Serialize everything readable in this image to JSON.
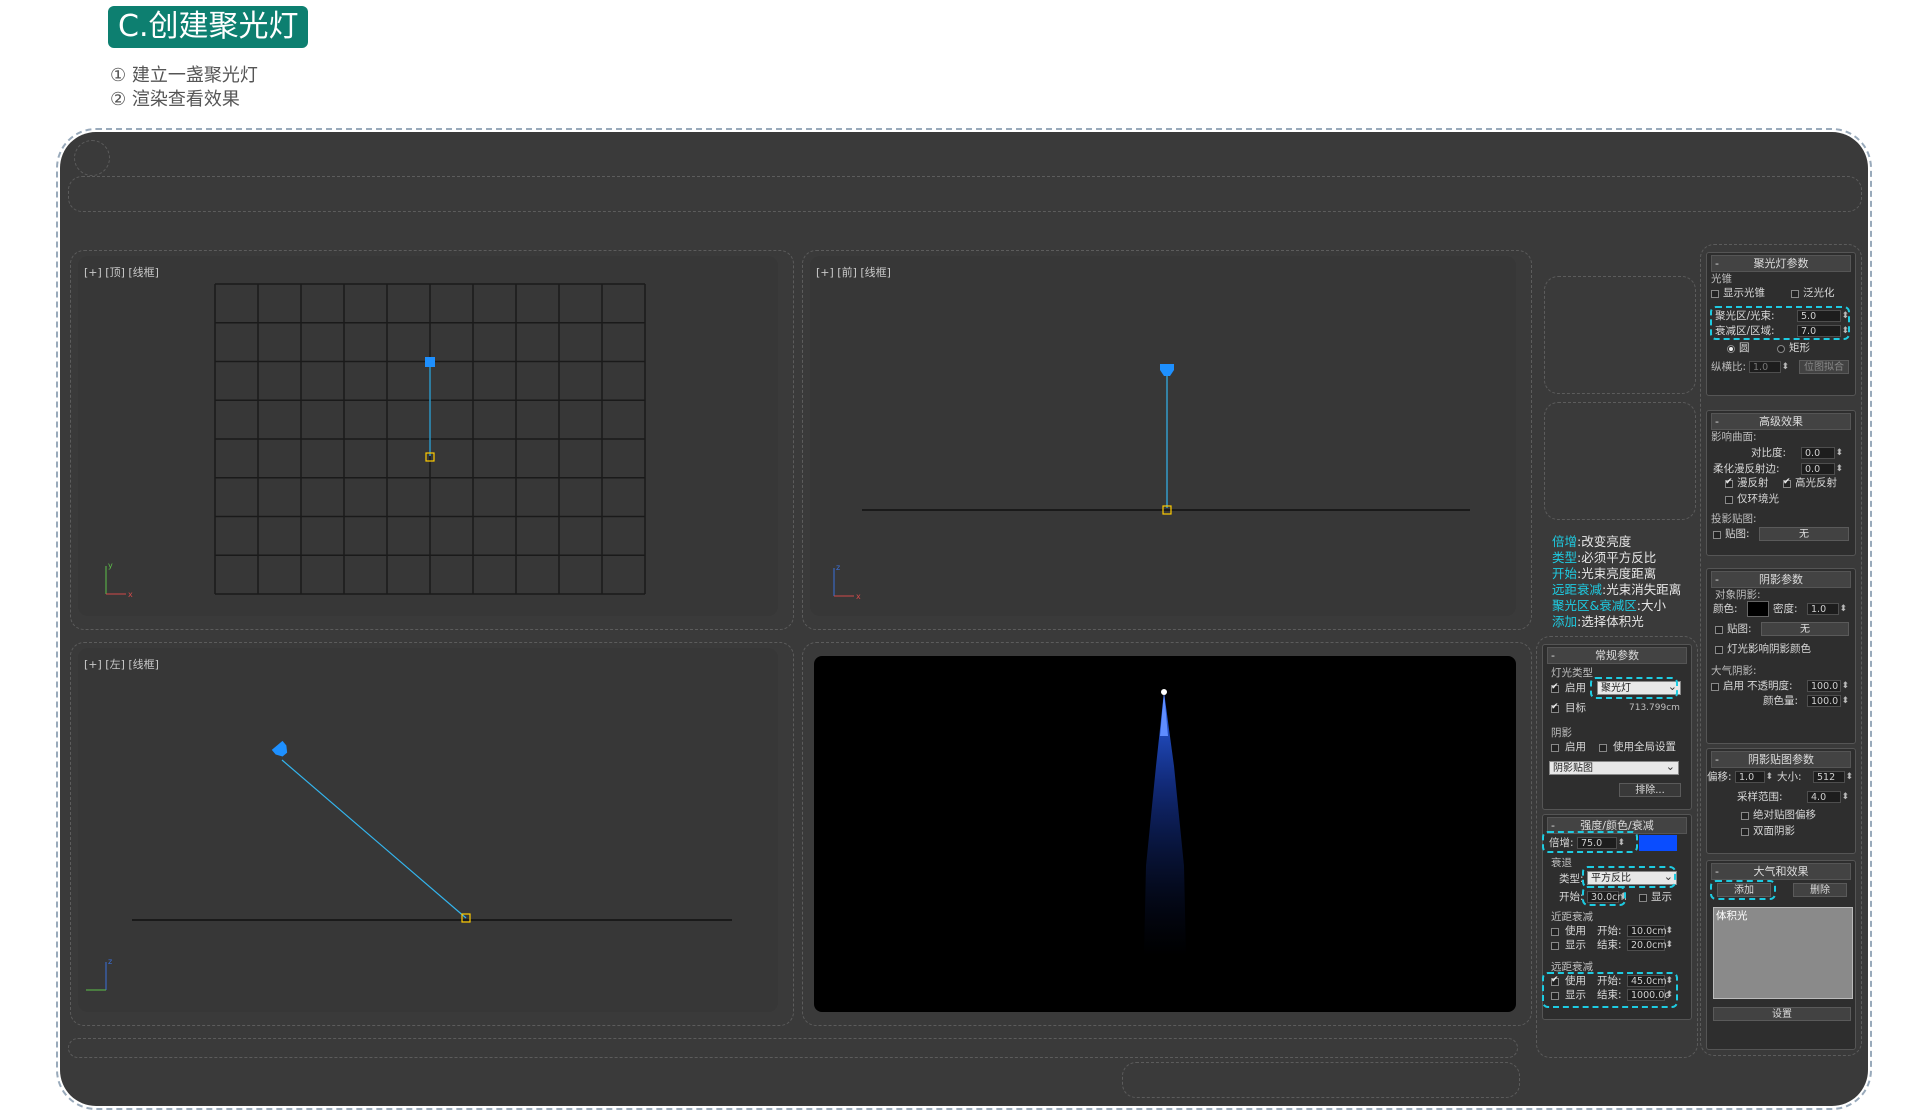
{
  "header": {
    "title": "C.创建聚光灯",
    "step1": "① 建立一盏聚光灯",
    "step2": "② 渲染查看效果"
  },
  "viewports": {
    "top": "[+] [顶] [线框]",
    "front": "[+] [前] [线框]",
    "left": "[+] [左] [线框]"
  },
  "notes": [
    {
      "k": "倍增",
      "v": ":改变亮度"
    },
    {
      "k": "类型",
      "v": ":必须平方反比"
    },
    {
      "k": "开始",
      "v": ":光束亮度距离"
    },
    {
      "k": "远距衰减",
      "v": ":光束消失距离"
    },
    {
      "k": "聚光区&衰减区",
      "v": ":大小"
    },
    {
      "k": "添加",
      "v": ":选择体积光"
    }
  ],
  "general": {
    "title": "常规参数",
    "light_type_group": "灯光类型",
    "enable": "启用",
    "type_value": "聚光灯",
    "target": "目标",
    "target_distance": "713.799cm",
    "shadow_group": "阴影",
    "shadow_enable": "启用",
    "use_global": "使用全局设置",
    "shadow_type": "阴影贴图",
    "exclude": "排除..."
  },
  "intensity": {
    "title": "强度/颜色/衰减",
    "multiplier_label": "倍增:",
    "multiplier_value": "75.0",
    "color": "#0a4dff",
    "decay_group": "衰退",
    "type_label": "类型:",
    "type_value": "平方反比",
    "start_label": "开始:",
    "start_value": "30.0cm",
    "show": "显示",
    "near_group": "近距衰减",
    "near_use": "使用",
    "near_show": "显示",
    "near_start_label": "开始:",
    "near_start_value": "10.0cm",
    "near_end_label": "结束:",
    "near_end_value": "20.0cm",
    "far_group": "远距衰减",
    "far_use": "使用",
    "far_show": "显示",
    "far_start_label": "开始:",
    "far_start_value": "45.0cm",
    "far_end_label": "结束:",
    "far_end_value": "1000.0c"
  },
  "spot": {
    "title": "聚光灯参数",
    "cone_group": "光锥",
    "show_cone": "显示光锥",
    "overshoot": "泛光化",
    "hotspot_label": "聚光区/光束:",
    "hotspot_value": "5.0",
    "falloff_label": "衰减区/区域:",
    "falloff_value": "7.0",
    "circle": "圆",
    "rect": "矩形",
    "aspect_label": "纵横比:",
    "aspect_value": "1.0",
    "bitmap_fit": "位图拟合"
  },
  "advanced": {
    "title": "高级效果",
    "affect_surfaces": "影响曲面:",
    "contrast_label": "对比度:",
    "contrast_value": "0.0",
    "soften_label": "柔化漫反射边:",
    "soften_value": "0.0",
    "diffuse": "漫反射",
    "specular": "高光反射",
    "ambient_only": "仅环境光",
    "projector_map": "投影贴图:",
    "map": "贴图:",
    "none": "无"
  },
  "shadow_params": {
    "title": "阴影参数",
    "object_shadows": "对象阴影:",
    "color_label": "颜色:",
    "density_label": "密度:",
    "density_value": "1.0",
    "map": "贴图:",
    "none": "无",
    "light_affects": "灯光影响阴影颜色",
    "atmos_group": "大气阴影:",
    "atmos_enable": "启用",
    "opacity_label": "不透明度:",
    "opacity_value": "100.0",
    "color_amount_label": "颜色量:",
    "color_amount_value": "100.0"
  },
  "shadow_map": {
    "title": "阴影贴图参数",
    "bias_label": "偏移:",
    "bias_value": "1.0",
    "size_label": "大小:",
    "size_value": "512",
    "sample_label": "采样范围:",
    "sample_value": "4.0",
    "absolute": "绝对贴图偏移",
    "two_sided": "双面阴影"
  },
  "atmos": {
    "title": "大气和效果",
    "add": "添加",
    "delete": "删除",
    "list_item": "体积光",
    "setup": "设置"
  }
}
